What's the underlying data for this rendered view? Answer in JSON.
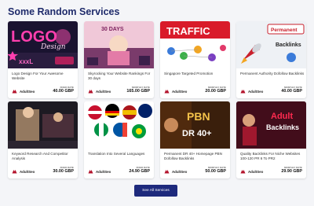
{
  "section": {
    "title": "Some Random Services"
  },
  "cards": [
    {
      "title": "Logo Design For Your Awesome Website",
      "price_label": "FIXED RATE",
      "price": "40.00 GBP",
      "seller": "AdultSeo",
      "thumb_text": "LOGO",
      "thumb_subtext": "Design",
      "thumb_extra": "xxxL"
    },
    {
      "title": "Skyrocking Your Website Rankings For 30 days",
      "price_label": "MONTHLY RATE",
      "price": "165.00 GBP",
      "seller": "AdultSeo",
      "thumb_text": "30 DAYS",
      "thumb_subtext": "",
      "thumb_extra": ""
    },
    {
      "title": "Singapore Targeted Promotion",
      "price_label": "MONTHLY RATE",
      "price": "20.00 GBP",
      "seller": "AdultSeo",
      "thumb_text": "TRAFFIC",
      "thumb_subtext": "",
      "thumb_extra": ""
    },
    {
      "title": "Permanent Authority Dofollow Backlinks",
      "price_label": "MONTHLY RATE",
      "price": "40.00 GBP",
      "seller": "AdultSeo",
      "thumb_text": "Permanent",
      "thumb_subtext": "Backlinks",
      "thumb_extra": ""
    },
    {
      "title": "Keyword Research And Competitor Analysis",
      "price_label": "FIXED RATE",
      "price": "30.00 GBP",
      "seller": "AdultSeo",
      "thumb_text": "",
      "thumb_subtext": "",
      "thumb_extra": ""
    },
    {
      "title": "Translation Into Several Languages",
      "price_label": "FIXED RATE",
      "price": "24.90 GBP",
      "seller": "AdultSeo",
      "thumb_text": "",
      "thumb_subtext": "",
      "thumb_extra": ""
    },
    {
      "title": "Permanent DR 40+ Homepage PBN Dofollow Backlinks",
      "price_label": "MONTHLY RATE",
      "price": "50.00 GBP",
      "seller": "AdultSeo",
      "thumb_text": "PBN",
      "thumb_subtext": "DR 40+",
      "thumb_extra": ""
    },
    {
      "title": "Quality Backlinks For Niche Websites 100-120 PR 6 To PR2",
      "price_label": "MONTHLY RATE",
      "price": "29.90 GBP",
      "seller": "AdultSeo",
      "thumb_text": "Adult",
      "thumb_subtext": "Backlinks",
      "thumb_extra": ""
    }
  ],
  "see_all": {
    "label": "See All Services"
  },
  "colors": {
    "title": "#1f2b6b",
    "button": "#1e2a7d",
    "button_text": "#ffffff"
  },
  "icons": {
    "seller": "seller-logo-icon"
  }
}
